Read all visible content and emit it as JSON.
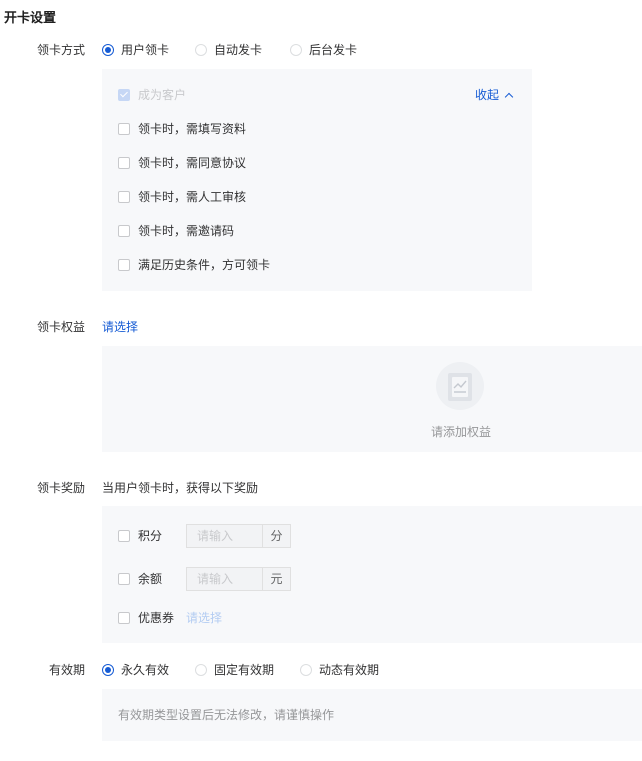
{
  "page_title": "开卡设置",
  "claim_method": {
    "label": "领卡方式",
    "options": [
      "用户领卡",
      "自动发卡",
      "后台发卡"
    ],
    "selected": "用户领卡",
    "panel": {
      "become_customer": "成为客户",
      "collapse": "收起",
      "conditions": [
        "领卡时，需填写资料",
        "领卡时，需同意协议",
        "领卡时，需人工审核",
        "领卡时，需邀请码",
        "满足历史条件，方可领卡"
      ]
    }
  },
  "benefits": {
    "label": "领卡权益",
    "select": "请选择",
    "empty_text": "请添加权益"
  },
  "rewards": {
    "label": "领卡奖励",
    "description": "当用户领卡时，获得以下奖励",
    "points": {
      "label": "积分",
      "placeholder": "请输入",
      "unit": "分"
    },
    "balance": {
      "label": "余额",
      "placeholder": "请输入",
      "unit": "元"
    },
    "coupon": {
      "label": "优惠券",
      "select": "请选择"
    }
  },
  "validity": {
    "label": "有效期",
    "options": [
      "永久有效",
      "固定有效期",
      "动态有效期"
    ],
    "selected": "永久有效",
    "note": "有效期类型设置后无法修改，请谨慎操作"
  },
  "colors": {
    "accent": "#155bd4",
    "panel_bg": "#f7f8fa"
  }
}
